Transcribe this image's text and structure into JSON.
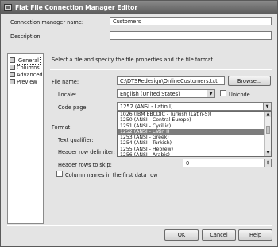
{
  "window": {
    "title": "Flat File Connection Manager Editor"
  },
  "top": {
    "conn_name_label": "Connection manager name:",
    "conn_name_value": "Customers",
    "description_label": "Description:",
    "description_value": ""
  },
  "nav": {
    "items": [
      {
        "label": "General"
      },
      {
        "label": "Columns"
      },
      {
        "label": "Advanced"
      },
      {
        "label": "Preview"
      }
    ]
  },
  "general": {
    "instruction": "Select a file and specify the file properties and the file format.",
    "file_name_label": "File name:",
    "file_name_value": "C:\\DTSRedesign\\OnlineCustomers.txt",
    "browse_label": "Browse...",
    "locale_label": "Locale:",
    "locale_value": "English (United States)",
    "unicode_label": "Unicode",
    "code_page_label": "Code page:",
    "code_page_value": "1252  (ANSI - Latin I)",
    "code_page_options": [
      "1026  (IBM EBCDIC - Turkish (Latin-5))",
      "1250  (ANSI - Central Europe)",
      "1251  (ANSI - Cyrillic)",
      "1252  (ANSI - Latin I)",
      "1253  (ANSI - Greek)",
      "1254  (ANSI - Turkish)",
      "1255  (ANSI - Hebrew)",
      "1256  (ANSI - Arabic)"
    ],
    "code_page_selected_index": 3,
    "format_label": "Format:",
    "text_qualifier_label": "Text qualifier:",
    "header_row_delim_label": "Header row delimiter:",
    "header_rows_skip_label": "Header rows to skip:",
    "header_rows_skip_value": "0",
    "column_names_label": "Column names in the first data row"
  },
  "buttons": {
    "ok": "OK",
    "cancel": "Cancel",
    "help": "Help"
  }
}
